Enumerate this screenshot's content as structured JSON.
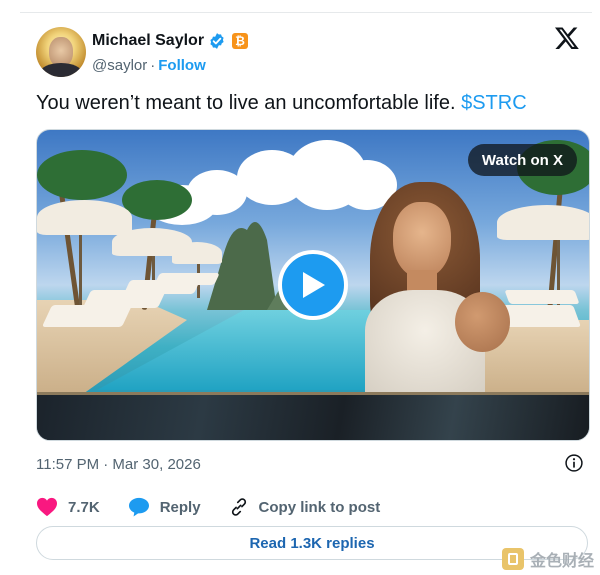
{
  "author": {
    "name": "Michael Saylor",
    "handle": "@saylor",
    "separator": "·",
    "follow_label": "Follow",
    "badge_symbol": "₿"
  },
  "tweet": {
    "text": "You weren’t meant to live an uncomfortable life.",
    "cashtag": "$STRC",
    "timestamp": "11:57 PM · Mar 30, 2026"
  },
  "media": {
    "watch_label": "Watch on X"
  },
  "actions": {
    "likes": "7.7K",
    "reply_label": "Reply",
    "copy_label": "Copy link to post"
  },
  "read_replies_label": "Read 1.3K replies",
  "watermark": "金色财经",
  "colors": {
    "accent": "#1d9bf0",
    "like": "#f91880",
    "bitcoin": "#f7931a"
  },
  "icons": [
    "verified-icon",
    "bitcoin-badge-icon",
    "x-logo-icon",
    "play-icon",
    "heart-icon",
    "reply-icon",
    "link-icon",
    "info-icon"
  ]
}
